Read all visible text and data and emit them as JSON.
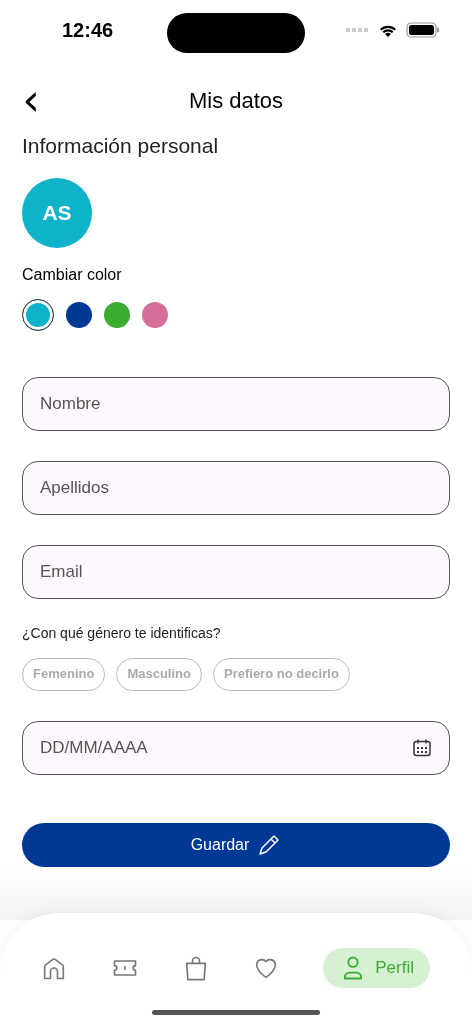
{
  "status_bar": {
    "time": "12:46"
  },
  "header": {
    "back": "‹",
    "title": "Mis datos"
  },
  "section_title": "Información personal",
  "avatar": {
    "initials": "AS"
  },
  "color_picker": {
    "label": "Cambiar color",
    "colors": [
      {
        "color": "#0fb3c9",
        "selected": true
      },
      {
        "color": "#003896",
        "selected": false
      },
      {
        "color": "#3aad30",
        "selected": false
      },
      {
        "color": "#d66e9a",
        "selected": false
      }
    ]
  },
  "fields": [
    {
      "placeholder": "Nombre"
    },
    {
      "placeholder": "Apellidos"
    },
    {
      "placeholder": "Email"
    }
  ],
  "gender": {
    "question": "¿Con qué género te identificas?",
    "options": [
      {
        "label": "Femenino",
        "selected": false
      },
      {
        "label": "Masculino",
        "selected": false
      },
      {
        "label": "Prefiero no decirlo",
        "selected": false
      }
    ]
  },
  "date_field": {
    "placeholder": "DD/MM/AAAA"
  },
  "save_button": {
    "label": "Guardar"
  },
  "bottom_nav": [
    {
      "selected": false
    },
    {
      "selected": false
    },
    {
      "selected": false
    },
    {
      "selected": false
    },
    {
      "label": "Perfil",
      "selected": true
    }
  ]
}
